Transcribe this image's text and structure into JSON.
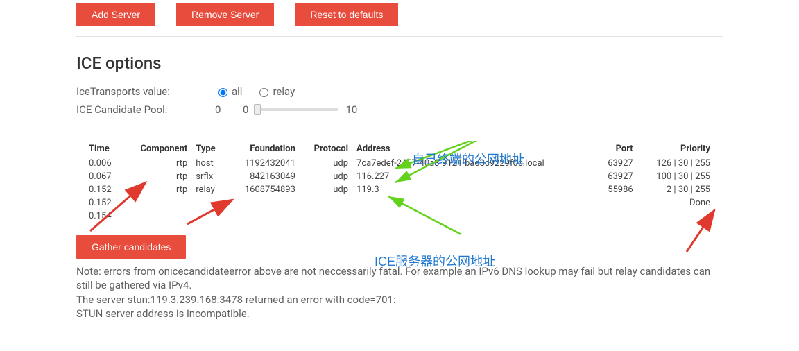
{
  "buttons": {
    "add_server": "Add Server",
    "remove_server": "Remove Server",
    "reset_defaults": "Reset to defaults",
    "gather": "Gather candidates"
  },
  "section_title": "ICE options",
  "ice_transports": {
    "label": "IceTransports value:",
    "opt_all": "all",
    "opt_relay": "relay",
    "selected": "all"
  },
  "ice_pool": {
    "label": "ICE Candidate Pool:",
    "value": "0",
    "min": "0",
    "max": "10"
  },
  "table": {
    "headers": {
      "time": "Time",
      "component": "Component",
      "type": "Type",
      "foundation": "Foundation",
      "protocol": "Protocol",
      "address": "Address",
      "port": "Port",
      "priority": "Priority"
    },
    "rows": [
      {
        "time": "0.006",
        "component": "rtp",
        "type": "host",
        "foundation": "1192432041",
        "protocol": "udp",
        "address": "7ca7edef-2467-40a3-9121-bad3c9229f0c.local",
        "port": "63927",
        "priority": "126 | 30 | 255"
      },
      {
        "time": "0.067",
        "component": "rtp",
        "type": "srflx",
        "foundation": "842163049",
        "protocol": "udp",
        "address": "116.227",
        "port": "63927",
        "priority": "100 | 30 | 255"
      },
      {
        "time": "0.152",
        "component": "rtp",
        "type": "relay",
        "foundation": "1608754893",
        "protocol": "udp",
        "address": "119.3",
        "port": "55986",
        "priority": "2 | 30 | 255"
      },
      {
        "time": "0.152",
        "component": "",
        "type": "",
        "foundation": "",
        "protocol": "",
        "address": "",
        "port": "",
        "priority": "Done"
      },
      {
        "time": "0.154",
        "component": "",
        "type": "",
        "foundation": "",
        "protocol": "",
        "address": "",
        "port": "",
        "priority": ""
      }
    ]
  },
  "note_lines": {
    "l1": "Note: errors from onicecandidateerror above are not neccessarily fatal. For example an IPv6 DNS lookup may fail but relay candidates can still be gathered via IPv4.",
    "l2": "The server stun:119.3.239.168:3478 returned an error with code=701:",
    "l3": "STUN server address is incompatible."
  },
  "annotations": {
    "own_addr": "自己终端的公网地址",
    "ice_server_addr": "ICE服务器的公网地址"
  }
}
